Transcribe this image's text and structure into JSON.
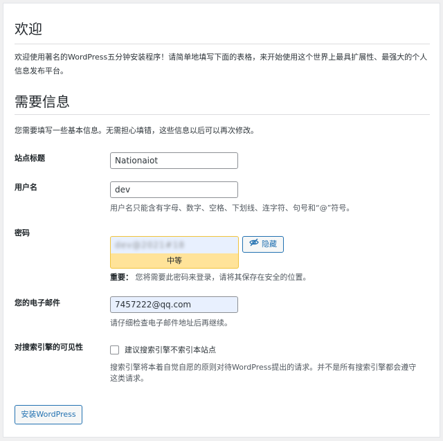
{
  "welcome": {
    "title": "欢迎",
    "intro": "欢迎使用著名的WordPress五分钟安装程序！请简单地填写下面的表格，来开始使用这个世界上最具扩展性、最强大的个人信息发布平台。"
  },
  "info": {
    "title": "需要信息",
    "subtitle": "您需要填写一些基本信息。无需担心填错，这些信息以后可以再次修改。"
  },
  "fields": {
    "site_title": {
      "label": "站点标题",
      "value": "Nationaiot"
    },
    "username": {
      "label": "用户名",
      "value": "dev",
      "hint": "用户名只能含有字母、数字、空格、下划线、连字符、句号和“@”符号。"
    },
    "password": {
      "label": "密码",
      "value": "dev@2021#18",
      "strength": "中等",
      "hide_label": "隐藏",
      "note_bold": "重要：",
      "note": "您将需要此密码来登录，请将其保存在安全的位置。"
    },
    "email": {
      "label": "您的电子邮件",
      "value": "7457222@qq.com",
      "hint": "请仔细检查电子邮件地址后再继续。"
    },
    "visibility": {
      "label": "对搜索引擎的可见性",
      "checkbox_label": "建议搜索引擎不索引本站点",
      "checked": false,
      "hint": "搜索引擎将本着自觉自愿的原则对待WordPress提出的请求。并不是所有搜索引擎都会遵守这类请求。"
    }
  },
  "install_button": "安装WordPress",
  "colors": {
    "accent": "#2271b1",
    "strength_bg": "#ffe399",
    "strength_border": "#f0c33c",
    "autofill_bg": "#e8f0fe"
  },
  "icons": {
    "hide": "eye-slash-icon"
  }
}
